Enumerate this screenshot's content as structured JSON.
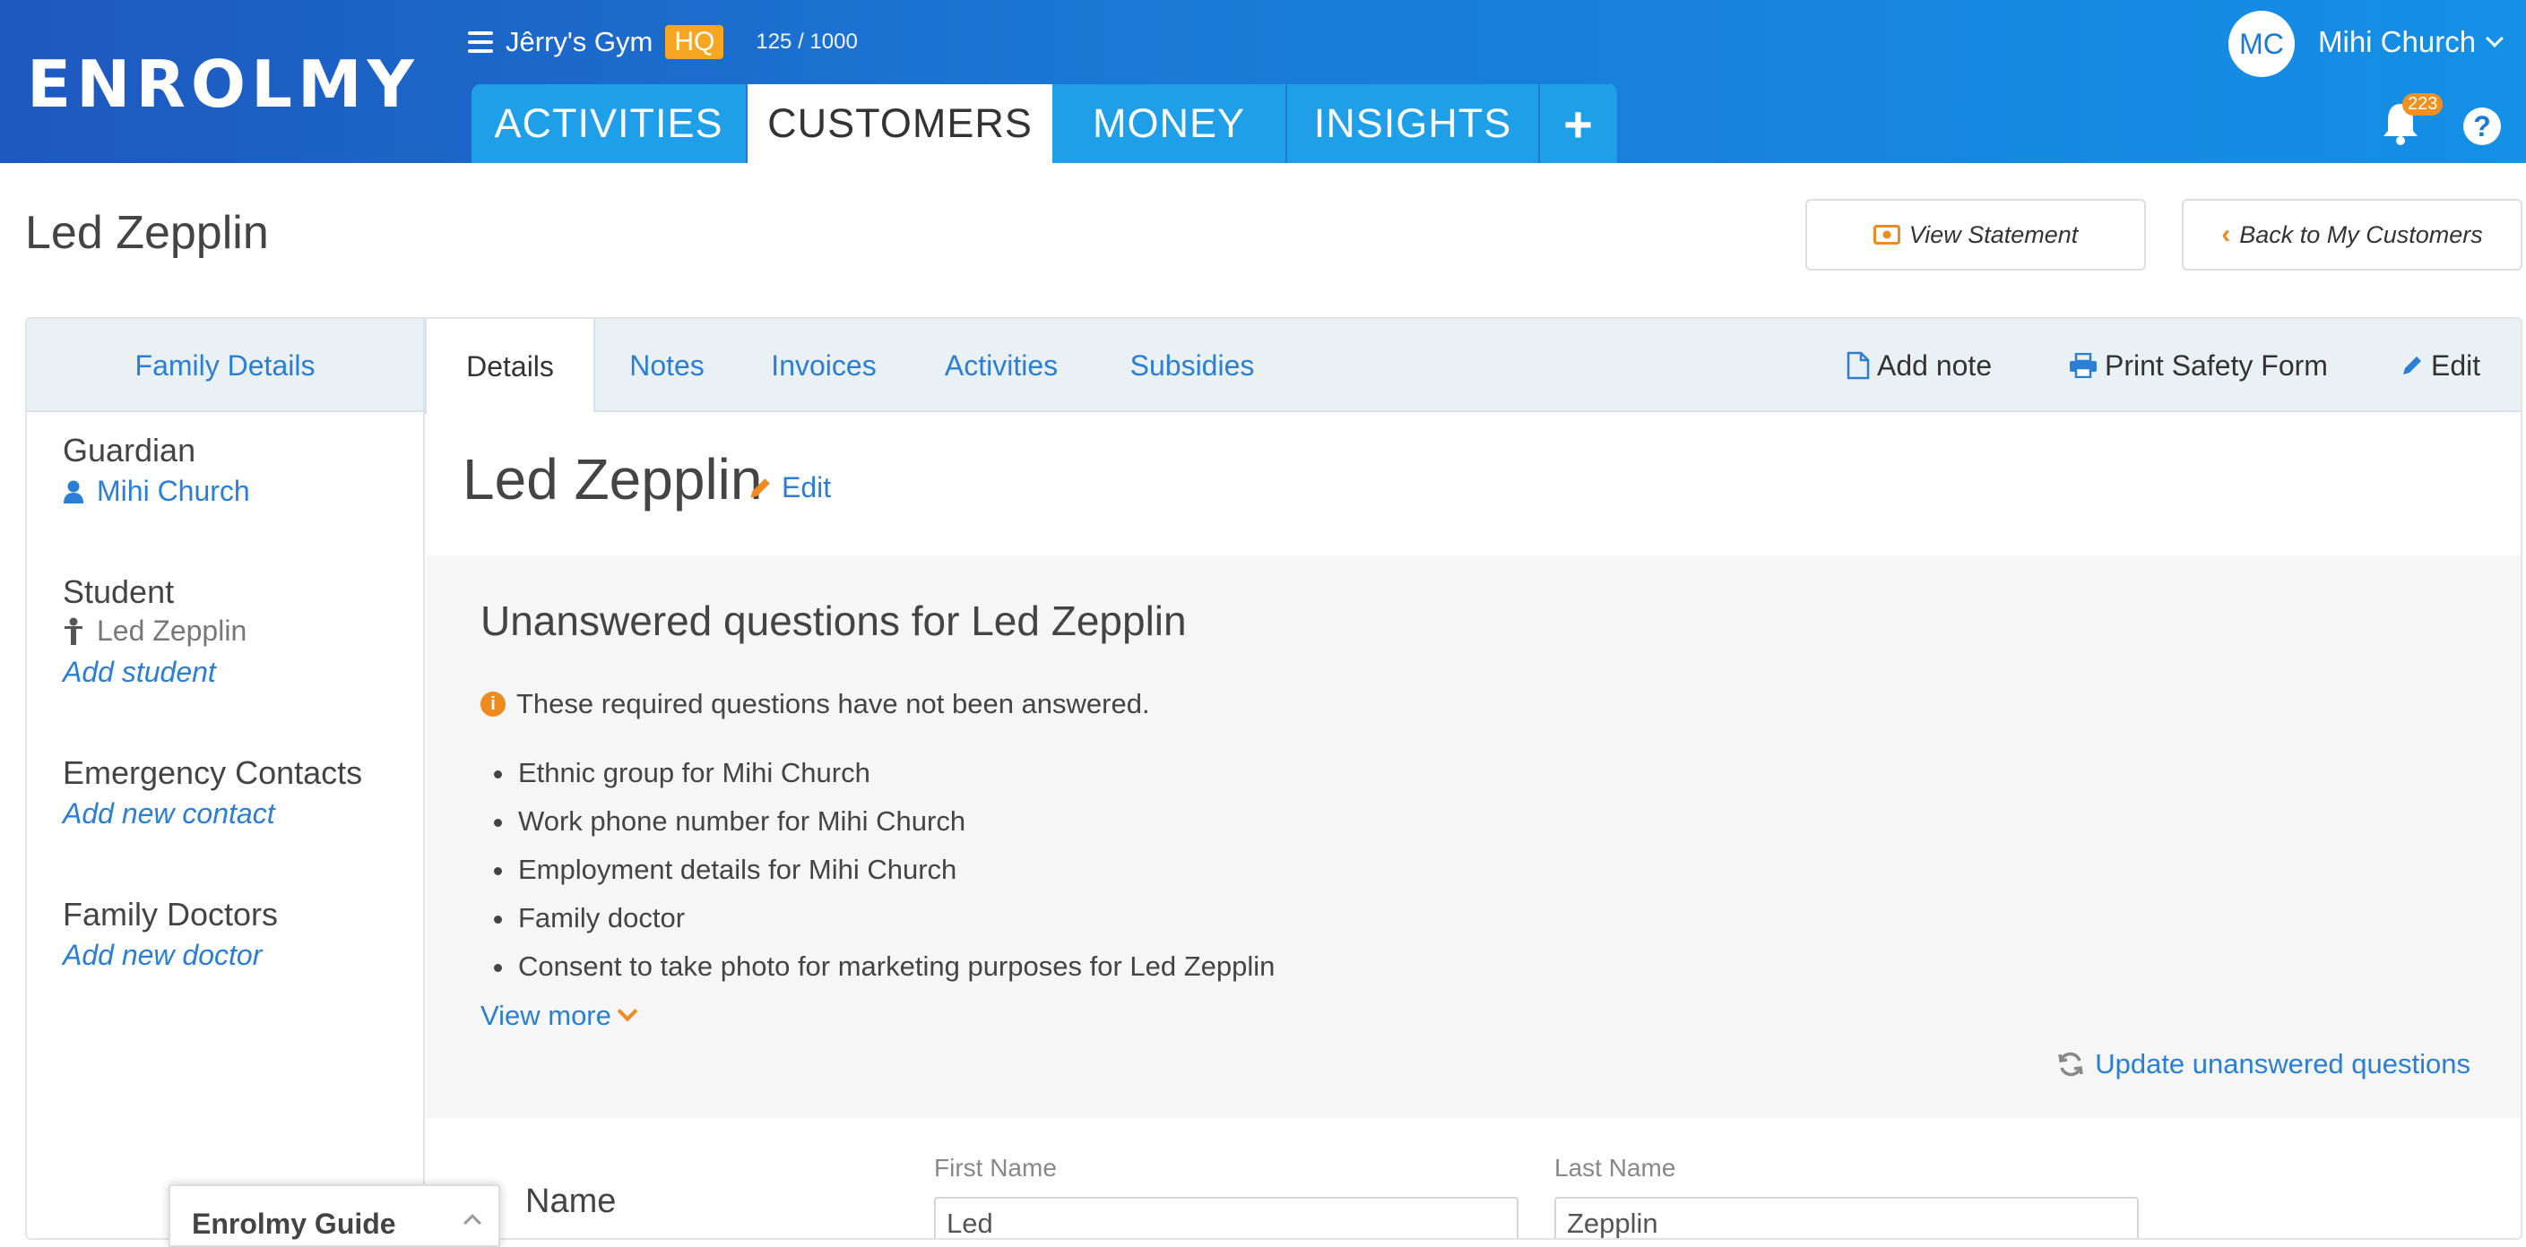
{
  "brand": {
    "logo_text": "ENROLMY"
  },
  "org": {
    "name": "Jêrry's Gym",
    "badge": "HQ",
    "count": "125 / 1000"
  },
  "nav": {
    "tabs": [
      "ACTIVITIES",
      "CUSTOMERS",
      "MONEY",
      "INSIGHTS"
    ],
    "active": "CUSTOMERS",
    "plus": "+"
  },
  "user": {
    "initials": "MC",
    "name": "Mihi Church",
    "notifications": "223",
    "help": "?"
  },
  "page": {
    "title": "Led Zepplin",
    "view_statement": "View Statement",
    "back": "Back to My Customers"
  },
  "tabs": {
    "family": "Family Details",
    "details": "Details",
    "notes": "Notes",
    "invoices": "Invoices",
    "activities": "Activities",
    "subsidies": "Subsidies",
    "add_note": "Add note",
    "print_safety": "Print Safety Form",
    "edit": "Edit"
  },
  "sidebar": {
    "guardian_heading": "Guardian",
    "guardian_name": "Mihi Church",
    "student_heading": "Student",
    "student_name": "Led Zepplin",
    "add_student": "Add student",
    "emergency_heading": "Emergency Contacts",
    "add_contact": "Add new contact",
    "doctors_heading": "Family Doctors",
    "add_doctor": "Add new doctor"
  },
  "main": {
    "title": "Led Zepplin",
    "edit": "Edit",
    "unanswered_title": "Unanswered questions for Led Zepplin",
    "unanswered_note": "These required questions have not been answered.",
    "questions": [
      "Ethnic group for Mihi Church",
      "Work phone number for Mihi Church",
      "Employment details for Mihi Church",
      "Family doctor",
      "Consent to take photo for marketing purposes for Led Zepplin"
    ],
    "view_more": "View more",
    "update": "Update unanswered questions",
    "name_label": "Name",
    "first_name_label": "First Name",
    "first_name_value": "Led",
    "last_name_label": "Last Name",
    "last_name_value": "Zepplin"
  },
  "guide": {
    "title": "Enrolmy Guide"
  },
  "colors": {
    "accent": "#2a7fd4",
    "orange": "#ef8a1e",
    "brand_blue": "#1a79d6"
  }
}
